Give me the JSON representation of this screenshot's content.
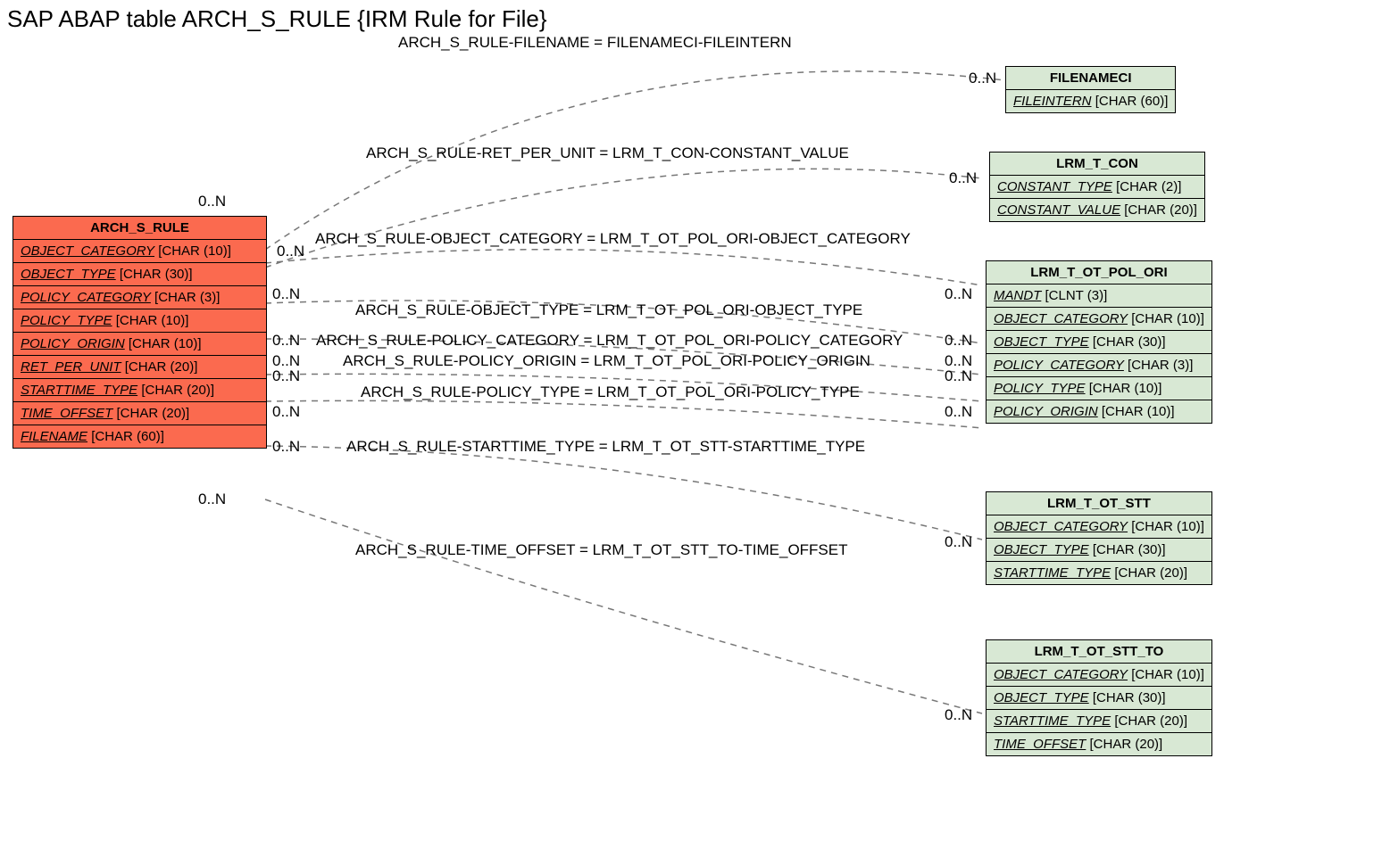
{
  "title": "SAP ABAP table ARCH_S_RULE {IRM Rule for File}",
  "main": {
    "name": "ARCH_S_RULE",
    "fields": [
      {
        "key": "OBJECT_CATEGORY",
        "type": "[CHAR (10)]"
      },
      {
        "key": "OBJECT_TYPE",
        "type": "[CHAR (30)]"
      },
      {
        "key": "POLICY_CATEGORY",
        "type": "[CHAR (3)]"
      },
      {
        "key": "POLICY_TYPE",
        "type": "[CHAR (10)]"
      },
      {
        "key": "POLICY_ORIGIN",
        "type": "[CHAR (10)]"
      },
      {
        "key": "RET_PER_UNIT",
        "type": "[CHAR (20)]"
      },
      {
        "key": "STARTTIME_TYPE",
        "type": "[CHAR (20)]"
      },
      {
        "key": "TIME_OFFSET",
        "type": "[CHAR (20)]"
      },
      {
        "key": "FILENAME",
        "type": "[CHAR (60)]"
      }
    ]
  },
  "refs": {
    "filenameci": {
      "name": "FILENAMECI",
      "fields": [
        {
          "key": "FILEINTERN",
          "type": "[CHAR (60)]"
        }
      ]
    },
    "lrm_t_con": {
      "name": "LRM_T_CON",
      "fields": [
        {
          "key": "CONSTANT_TYPE",
          "type": "[CHAR (2)]"
        },
        {
          "key": "CONSTANT_VALUE",
          "type": "[CHAR (20)]"
        }
      ]
    },
    "lrm_t_ot_pol_ori": {
      "name": "LRM_T_OT_POL_ORI",
      "fields": [
        {
          "key": "MANDT",
          "type": "[CLNT (3)]"
        },
        {
          "key": "OBJECT_CATEGORY",
          "type": "[CHAR (10)]"
        },
        {
          "key": "OBJECT_TYPE",
          "type": "[CHAR (30)]"
        },
        {
          "key": "POLICY_CATEGORY",
          "type": "[CHAR (3)]"
        },
        {
          "key": "POLICY_TYPE",
          "type": "[CHAR (10)]"
        },
        {
          "key": "POLICY_ORIGIN",
          "type": "[CHAR (10)]"
        }
      ]
    },
    "lrm_t_ot_stt": {
      "name": "LRM_T_OT_STT",
      "fields": [
        {
          "key": "OBJECT_CATEGORY",
          "type": "[CHAR (10)]"
        },
        {
          "key": "OBJECT_TYPE",
          "type": "[CHAR (30)]"
        },
        {
          "key": "STARTTIME_TYPE",
          "type": "[CHAR (20)]"
        }
      ]
    },
    "lrm_t_ot_stt_to": {
      "name": "LRM_T_OT_STT_TO",
      "fields": [
        {
          "key": "OBJECT_CATEGORY",
          "type": "[CHAR (10)]"
        },
        {
          "key": "OBJECT_TYPE",
          "type": "[CHAR (30)]"
        },
        {
          "key": "STARTTIME_TYPE",
          "type": "[CHAR (20)]"
        },
        {
          "key": "TIME_OFFSET",
          "type": "[CHAR (20)]"
        }
      ]
    }
  },
  "relations": [
    {
      "text": "ARCH_S_RULE-FILENAME = FILENAMECI-FILEINTERN",
      "lc": "0..N",
      "rc": "0..N"
    },
    {
      "text": "ARCH_S_RULE-RET_PER_UNIT = LRM_T_CON-CONSTANT_VALUE",
      "lc": "0..N",
      "rc": "0..N"
    },
    {
      "text": "ARCH_S_RULE-OBJECT_CATEGORY = LRM_T_OT_POL_ORI-OBJECT_CATEGORY",
      "lc": "0..N",
      "rc": "0..N"
    },
    {
      "text": "ARCH_S_RULE-OBJECT_TYPE = LRM_T_OT_POL_ORI-OBJECT_TYPE",
      "lc": "0..N",
      "rc": "0..N"
    },
    {
      "text": "ARCH_S_RULE-POLICY_CATEGORY = LRM_T_OT_POL_ORI-POLICY_CATEGORY",
      "lc": "0..N",
      "rc": "0..N"
    },
    {
      "text": "ARCH_S_RULE-POLICY_ORIGIN = LRM_T_OT_POL_ORI-POLICY_ORIGIN",
      "lc": "0..N",
      "rc": "0..N"
    },
    {
      "text": "ARCH_S_RULE-POLICY_TYPE = LRM_T_OT_POL_ORI-POLICY_TYPE",
      "lc": "0..N",
      "rc": "0..N"
    },
    {
      "text": "ARCH_S_RULE-STARTTIME_TYPE = LRM_T_OT_STT-STARTTIME_TYPE",
      "lc": "0..N",
      "rc": "0..N"
    },
    {
      "text": "ARCH_S_RULE-TIME_OFFSET = LRM_T_OT_STT_TO-TIME_OFFSET",
      "lc": "0..N",
      "rc": "0..N"
    }
  ],
  "cards": {
    "zeroN": "0..N"
  }
}
